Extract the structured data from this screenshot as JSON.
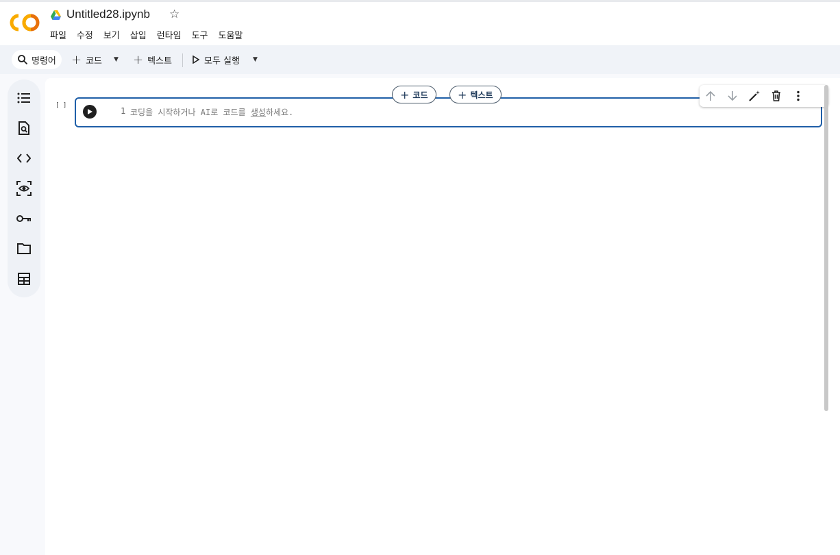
{
  "app": {
    "notebook_title": "Untitled28.ipynb",
    "logo_icon": "colab-logo",
    "drive_icon": "google-drive-icon",
    "star_icon": "star-outline-icon"
  },
  "menu": [
    "파일",
    "수정",
    "보기",
    "삽입",
    "런타임",
    "도구",
    "도움말"
  ],
  "toolbar": {
    "command_label": "명령어",
    "add_code_label": "코드",
    "add_text_label": "텍스트",
    "run_all_label": "모두 실행"
  },
  "sidebar": {
    "items": [
      "table-of-contents-icon",
      "find-replace-icon",
      "code-snippets-icon",
      "variables-icon",
      "secrets-key-icon",
      "files-folder-icon",
      "data-table-icon"
    ]
  },
  "cell": {
    "execution_count": "[ ]",
    "line_number": "1",
    "placeholder_start": "코딩을 시작하거나 AI로 코드를 ",
    "placeholder_link": "생성",
    "placeholder_end": "하세요."
  },
  "insert_pills": {
    "code_label": "코드",
    "text_label": "텍스트"
  },
  "colors": {
    "accent": "#1f5fa8",
    "logo_orange": "#f9ab00",
    "logo_dark_orange": "#e8710a"
  }
}
